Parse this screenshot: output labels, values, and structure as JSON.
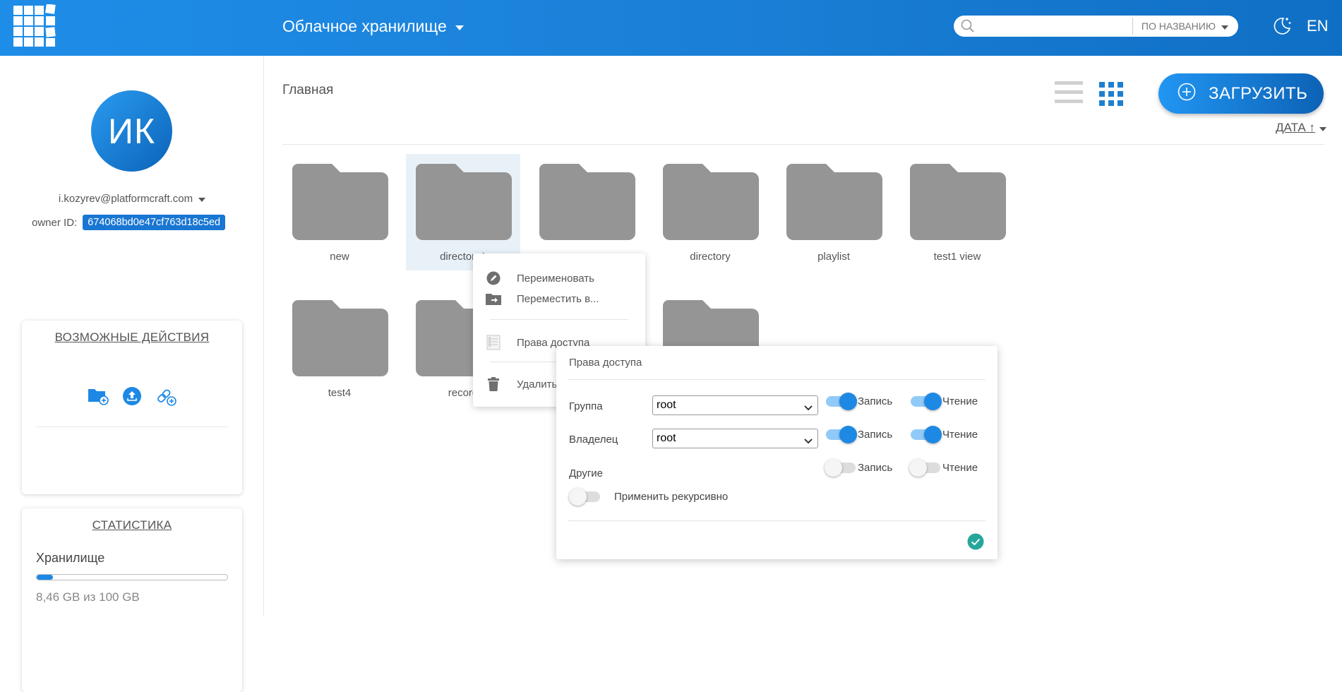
{
  "header": {
    "app_title": "Облачное хранилище",
    "search_placeholder": "",
    "search_sort": "ПО НАЗВАНИЮ",
    "language": "EN"
  },
  "sidebar": {
    "avatar_initials": "ИК",
    "email": "i.kozyrev@platformcraft.com",
    "owner_label": "owner ID:",
    "owner_id": "674068bd0e47cf763d18c5ed",
    "actions_title": "ВОЗМОЖНЫЕ ДЕЙСТВИЯ",
    "stats_title": "СТАТИСТИКА",
    "storage_label": "Хранилище",
    "storage_used_fraction": 0.0846,
    "storage_text": "8,46 GB из 100 GB"
  },
  "main": {
    "breadcrumb": "Главная",
    "upload_label": "ЗАГРУЗИТЬ",
    "sort_label": "ДАТА ↑",
    "folders_row1": [
      "new",
      "directory1",
      "",
      "directory",
      "playlist",
      "test1 view"
    ],
    "folders_row2": [
      "test4",
      "record",
      "",
      ""
    ]
  },
  "context_menu": {
    "rename": "Переименовать",
    "move": "Переместить в...",
    "access": "Права доступа",
    "delete": "Удалить"
  },
  "permissions": {
    "title": "Права доступа",
    "group_label": "Группа",
    "group_value": "root",
    "owner_label": "Владелец",
    "owner_value": "root",
    "others_label": "Другие",
    "write_label": "Запись",
    "read_label": "Чтение",
    "recursive_label": "Применить рекурсивно",
    "group_write": true,
    "group_read": true,
    "owner_write": true,
    "owner_read": true,
    "others_write": false,
    "others_read": false,
    "recursive": false
  },
  "colors": {
    "header_start": "#1e8de8",
    "header_end": "#0f6fc4",
    "accent": "#1e88e5",
    "folder": "#959595",
    "confirm": "#26a69a"
  }
}
